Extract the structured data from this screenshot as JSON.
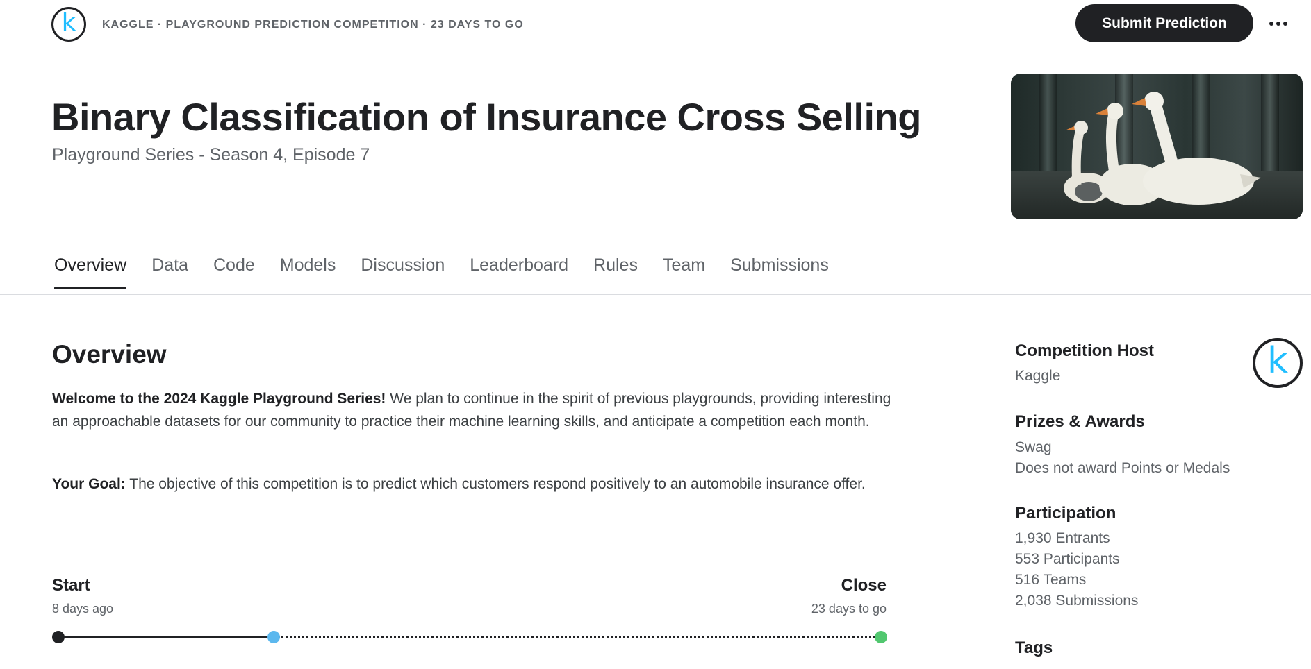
{
  "header": {
    "breadcrumb": "KAGGLE · PLAYGROUND PREDICTION COMPETITION · 23 DAYS TO GO",
    "submit_label": "Submit Prediction",
    "title": "Binary Classification of Insurance Cross Selling",
    "subtitle": "Playground Series - Season 4, Episode 7"
  },
  "tabs": [
    {
      "label": "Overview",
      "active": true
    },
    {
      "label": "Data"
    },
    {
      "label": "Code"
    },
    {
      "label": "Models"
    },
    {
      "label": "Discussion"
    },
    {
      "label": "Leaderboard"
    },
    {
      "label": "Rules"
    },
    {
      "label": "Team"
    },
    {
      "label": "Submissions"
    }
  ],
  "overview": {
    "heading": "Overview",
    "p1_bold": "Welcome to the 2024 Kaggle Playground Series!",
    "p1_text": " We plan to continue in the spirit of previous playgrounds, providing interesting an approachable datasets for our community to practice their machine learning skills, and anticipate a competition each month.",
    "p2_bold": "Your Goal:",
    "p2_text": " The objective of this competition is to predict which customers respond positively to an automobile insurance offer."
  },
  "timeline": {
    "start_label": "Start",
    "start_sub": "8 days ago",
    "close_label": "Close",
    "close_sub": "23 days to go"
  },
  "sidebar": {
    "host_heading": "Competition Host",
    "host_name": "Kaggle",
    "prizes_heading": "Prizes & Awards",
    "prize_1": "Swag",
    "prize_2": "Does not award Points or Medals",
    "participation_heading": "Participation",
    "entrants": "1,930 Entrants",
    "participants": "553 Participants",
    "teams": "516 Teams",
    "submissions": "2,038 Submissions",
    "tags_heading": "Tags"
  },
  "logo": {
    "letter": "k"
  },
  "colors": {
    "kaggle_blue": "#20beff",
    "dark": "#202124",
    "timeline_now": "#5cb8ee",
    "timeline_end": "#51c76f"
  },
  "icons": [
    "kaggle-logo-icon",
    "more-options-icon",
    "kaggle-host-logo-icon"
  ]
}
